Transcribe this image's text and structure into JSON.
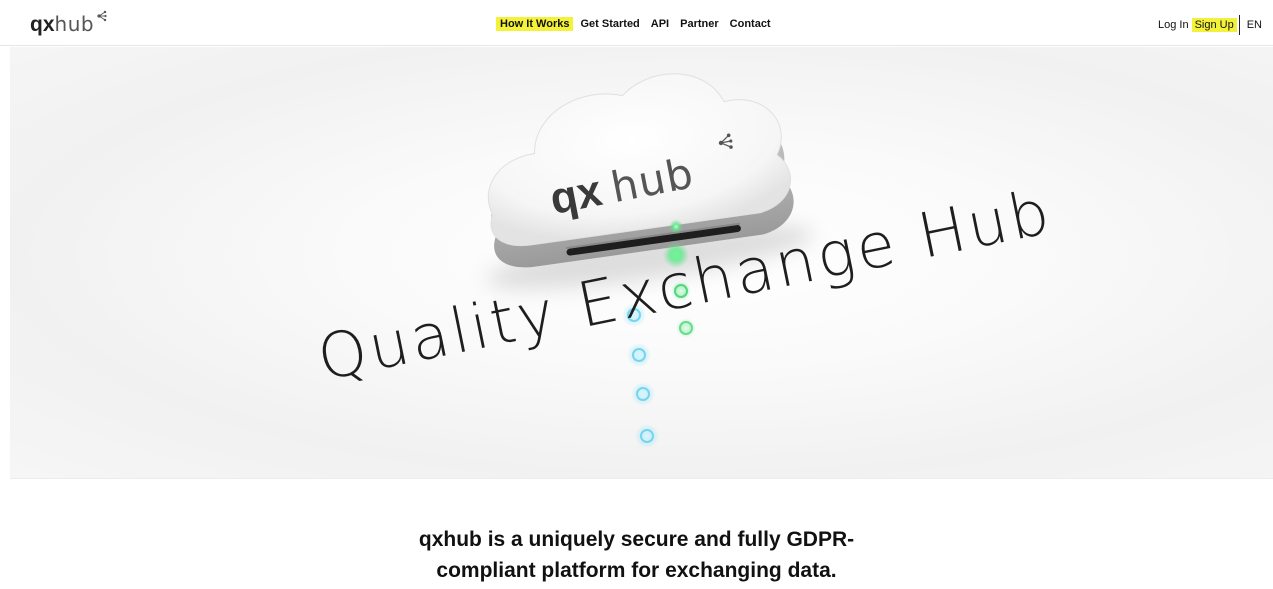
{
  "header": {
    "logo": {
      "bold": "qx",
      "light": "hub"
    },
    "nav": [
      {
        "label": "How It Works",
        "highlighted": true
      },
      {
        "label": "Get Started",
        "highlighted": false
      },
      {
        "label": "API",
        "highlighted": false
      },
      {
        "label": "Partner",
        "highlighted": false
      },
      {
        "label": "Contact",
        "highlighted": false
      }
    ],
    "login_label": "Log In",
    "signup_label": "Sign Up",
    "language_label": "EN"
  },
  "hero": {
    "cloud_logo": {
      "bold": "qx",
      "light": "hub"
    },
    "title": "Quality Exchange Hub"
  },
  "tagline": {
    "line1": "qxhub is a uniquely secure and fully GDPR-",
    "line2": "compliant platform for exchanging data."
  },
  "colors": {
    "highlight": "#f4f13a",
    "text": "#111111",
    "led_green": "#39d96a",
    "ring_blue": "#6fd3ec"
  }
}
